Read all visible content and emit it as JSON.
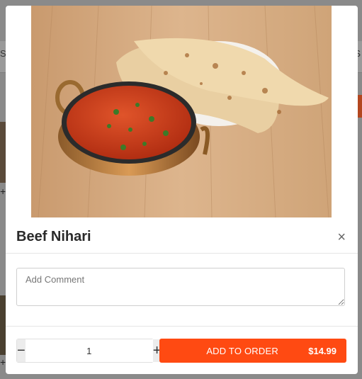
{
  "background": {
    "left_text": "Si",
    "right_text": "S"
  },
  "modal": {
    "image_alt": "Beef Nihari with naan",
    "title": "Beef Nihari",
    "close_symbol": "×",
    "comment": {
      "placeholder": "Add Comment",
      "value": ""
    },
    "quantity": {
      "minus_symbol": "−",
      "plus_symbol": "+",
      "value": "1"
    },
    "add_button": {
      "label": "ADD TO ORDER",
      "price": "$14.99"
    }
  },
  "colors": {
    "accent": "#ff4a12",
    "overlay": "#8c8c8c"
  },
  "icons": {
    "close": "close-icon",
    "minus": "minus-icon",
    "plus": "plus-icon"
  }
}
